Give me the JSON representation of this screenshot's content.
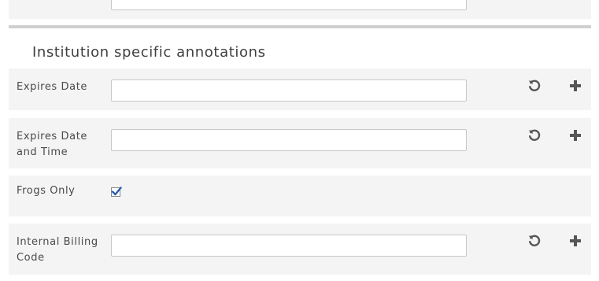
{
  "previous_row": {
    "label": "",
    "value": ""
  },
  "section": {
    "title": "Institution specific annotations"
  },
  "fields": {
    "expires_date": {
      "label": "Expires Date",
      "value": ""
    },
    "expires_date_time": {
      "label": "Expires Date and Time",
      "value": ""
    },
    "frogs_only": {
      "label": "Frogs Only",
      "checked": true
    },
    "internal_billing_code": {
      "label": "Internal Billing Code",
      "value": ""
    }
  },
  "icons": {
    "reset": "undo-icon",
    "add": "plus-icon"
  },
  "colors": {
    "row_background": "#f4f4f4",
    "checkbox_mark": "#2a5db0",
    "icon": "#555555"
  }
}
